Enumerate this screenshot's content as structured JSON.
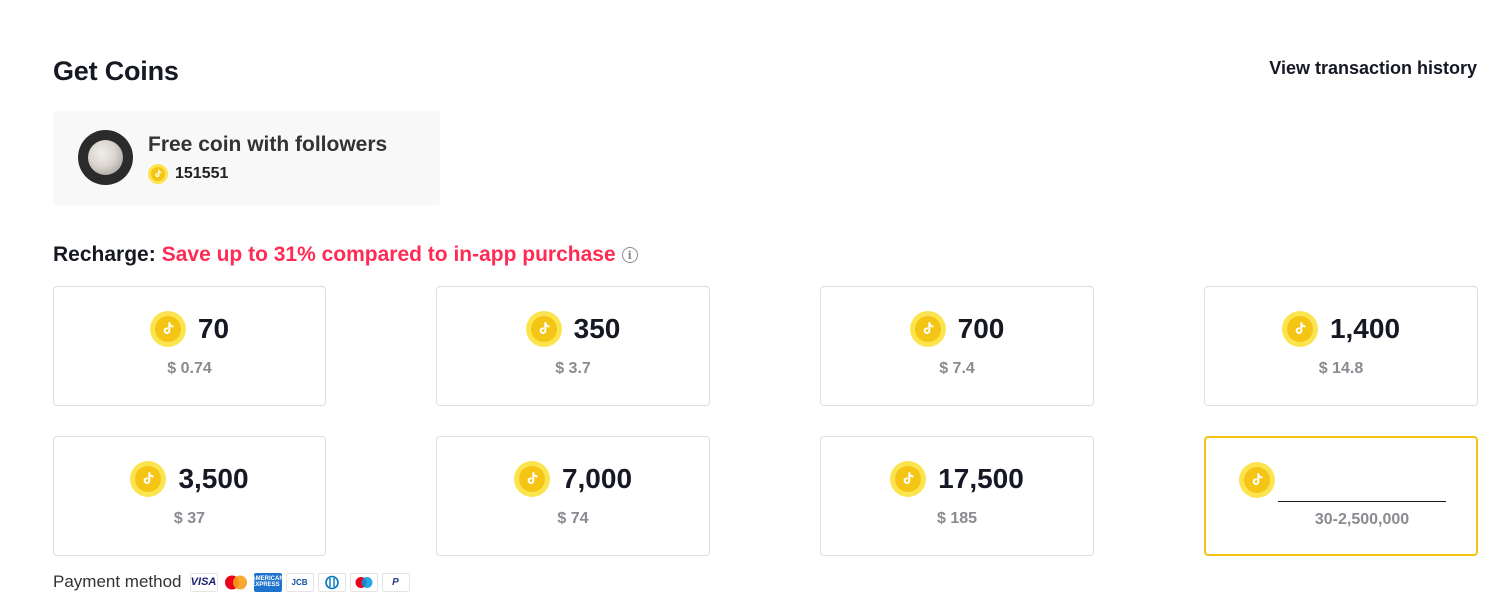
{
  "header": {
    "title": "Get Coins",
    "history_link": "View transaction history"
  },
  "free_coins": {
    "title": "Free coin with followers",
    "count": "151551"
  },
  "recharge": {
    "label": "Recharge:",
    "promo": "Save up to 31% compared to in-app purchase",
    "info_icon": "info-icon"
  },
  "packages": [
    {
      "amount": "70",
      "price": "$ 0.74"
    },
    {
      "amount": "350",
      "price": "$ 3.7"
    },
    {
      "amount": "700",
      "price": "$ 7.4"
    },
    {
      "amount": "1,400",
      "price": "$ 14.8"
    },
    {
      "amount": "3,500",
      "price": "$ 37"
    },
    {
      "amount": "7,000",
      "price": "$ 74"
    },
    {
      "amount": "17,500",
      "price": "$ 185"
    }
  ],
  "custom": {
    "value": "",
    "range": "30-2,500,000"
  },
  "payment": {
    "label": "Payment method",
    "methods": [
      {
        "name": "visa",
        "text": "VISA"
      },
      {
        "name": "mastercard",
        "text": ""
      },
      {
        "name": "amex",
        "text": "AMERICAN EXPRESS"
      },
      {
        "name": "jcb",
        "text": "JCB"
      },
      {
        "name": "diners",
        "text": ""
      },
      {
        "name": "maestro",
        "text": ""
      },
      {
        "name": "paypal",
        "text": "P"
      }
    ]
  },
  "colors": {
    "promo": "#fe2c55",
    "coin": "#f5c516",
    "selected_border": "#f5c516",
    "muted": "#8a8b91"
  }
}
